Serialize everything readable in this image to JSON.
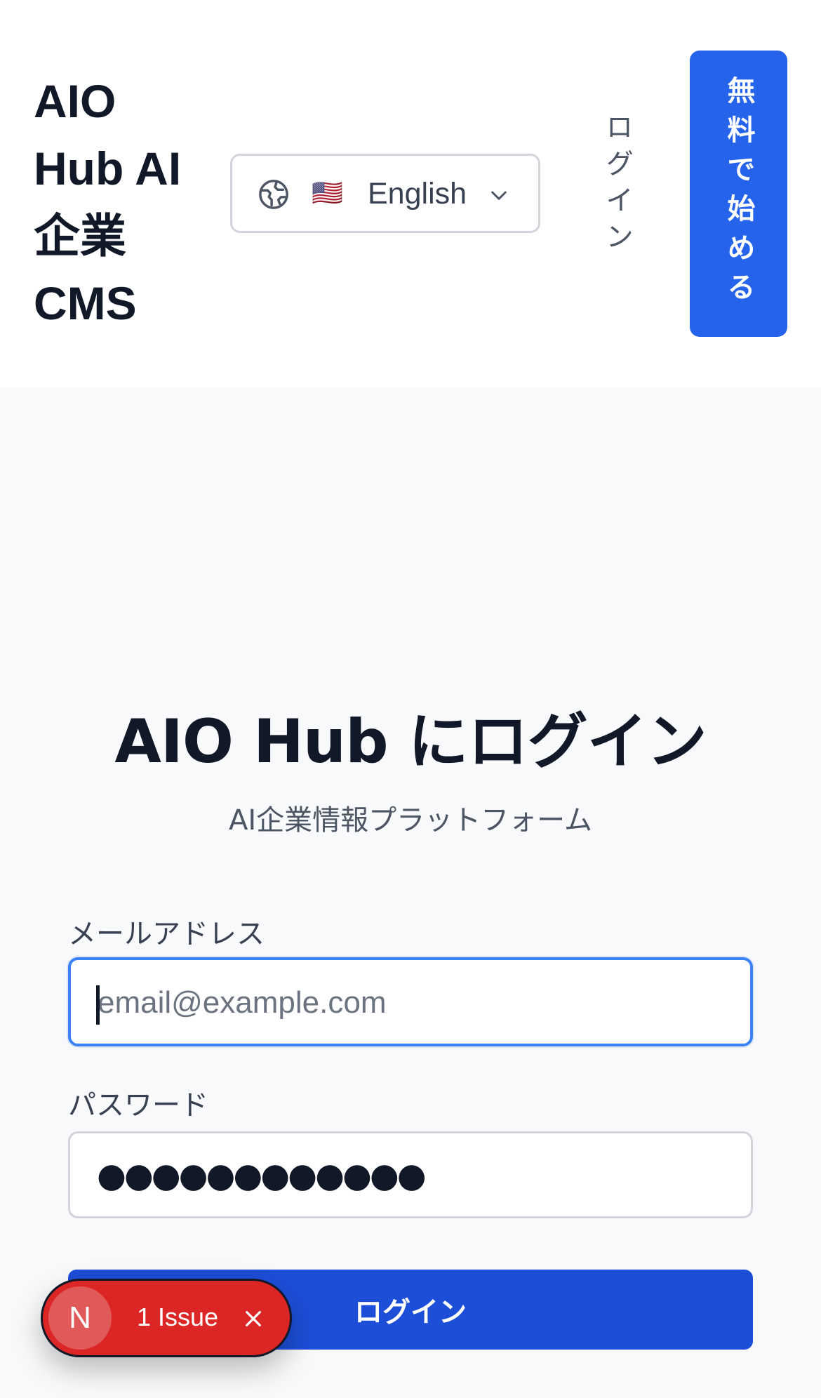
{
  "header": {
    "brand": "AIO Hub AI 企業 CMS",
    "language": {
      "flag": "🇺🇸",
      "label": "English",
      "icon": "globe-icon",
      "dropdown_icon": "chevron-down-icon"
    },
    "login_link": "ログイン",
    "signup_button": "無料で始める"
  },
  "main": {
    "title": "AIO Hub にログイン",
    "subtitle": "AI企業情報プラットフォーム",
    "email": {
      "label": "メールアドレス",
      "placeholder": "email@example.com"
    },
    "password": {
      "label": "パスワード",
      "masked_value": "●●●●●●●●●●●●"
    },
    "submit_label": "ログイン"
  },
  "dev_badge": {
    "logo": "N",
    "text": "1 Issue",
    "close_icon": "close-icon"
  },
  "colors": {
    "primary": "#2563eb",
    "primary_dark": "#1d4ed8",
    "focus_ring": "#3b82f6",
    "badge_red": "#dc2626"
  }
}
